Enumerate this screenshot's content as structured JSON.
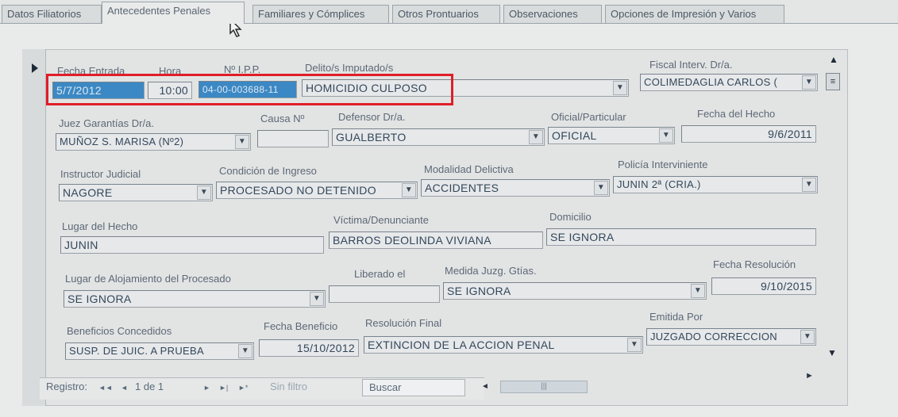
{
  "tabs": [
    "Datos Filiatorios",
    "Antecedentes Penales",
    "Familiares y Cómplices",
    "Otros Prontuarios",
    "Observaciones",
    "Opciones de Impresión y Varios"
  ],
  "active_tab": "Antecedentes Penales",
  "labels": {
    "fecha_entrada": "Fecha Entrada",
    "hora": "Hora",
    "nipp": "Nº I.P.P.",
    "delito": "Delito/s Imputado/s",
    "fiscal": "Fiscal Interv. Dr/a.",
    "juez": "Juez Garantías Dr/a.",
    "causa": "Causa Nº",
    "defensor": "Defensor Dr/a.",
    "oficial_particular": "Oficial/Particular",
    "fecha_hecho": "Fecha del Hecho",
    "instructor": "Instructor Judicial",
    "condicion": "Condición de Ingreso",
    "modalidad": "Modalidad Delictiva",
    "policia": "Policía Interviniente",
    "lugar_hecho": "Lugar del Hecho",
    "victima": "Víctima/Denunciante",
    "domicilio": "Domicilio",
    "lugar_alojamiento": "Lugar de Alojamiento del Procesado",
    "liberado": "Liberado el",
    "medida": "Medida Juzg. Gtías.",
    "fecha_resolucion": "Fecha Resolución",
    "beneficios": "Beneficios Concedidos",
    "fecha_beneficio": "Fecha Beneficio",
    "resolucion_final": "Resolución Final",
    "emitida_por": "Emitida Por"
  },
  "values": {
    "fecha_entrada": "5/7/2012",
    "hora": "10:00",
    "nipp": "04-00-003688-11",
    "delito": "HOMICIDIO CULPOSO",
    "fiscal": "COLIMEDAGLIA CARLOS (",
    "juez": "MUÑOZ S. MARISA (Nº2)",
    "causa": "",
    "defensor": "GUALBERTO",
    "oficial_particular": "OFICIAL",
    "fecha_hecho": "9/6/2011",
    "instructor": "NAGORE",
    "condicion": "PROCESADO NO DETENIDO",
    "modalidad": "ACCIDENTES",
    "policia": "JUNIN 2ª (CRIA.)",
    "lugar_hecho": "JUNIN",
    "victima": "BARROS DEOLINDA VIVIANA",
    "domicilio": "SE IGNORA",
    "lugar_alojamiento": "SE IGNORA",
    "liberado": "",
    "medida": "SE IGNORA",
    "fecha_resolucion": "9/10/2015",
    "beneficios": "SUSP. DE JUIC. A PRUEBA",
    "fecha_beneficio": "15/10/2012",
    "resolucion_final": "EXTINCION DE LA ACCION PENAL",
    "emitida_por": "JUZGADO CORRECCION"
  },
  "nav": {
    "registro": "Registro:",
    "first": "◄◄",
    "prev": "◄",
    "position": "1 de 1",
    "next": "►",
    "last": "►|",
    "new": "►*",
    "filter": "Sin filtro",
    "search": "Buscar"
  },
  "colors": {
    "highlight_border": "#e01e28",
    "selected_field": "#3b88c4"
  }
}
